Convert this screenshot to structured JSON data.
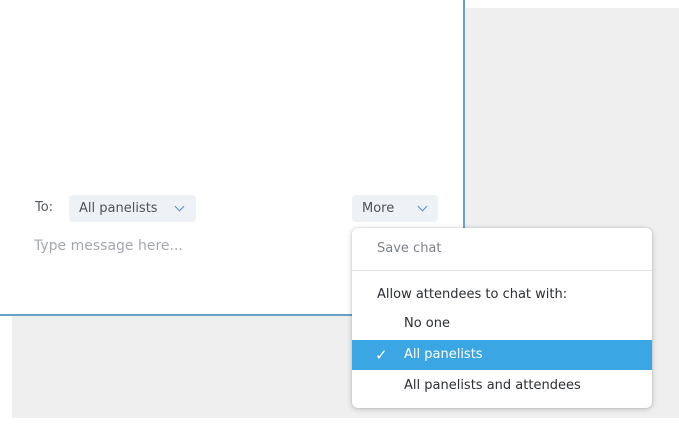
{
  "chat": {
    "to_label": "To:",
    "recipient": "All panelists",
    "more_label": "More",
    "message_placeholder": "Type message here..."
  },
  "menu": {
    "save_chat": "Save chat",
    "allow_label": "Allow attendees to chat with:",
    "selected_option": "All panelists",
    "options": [
      {
        "label": "No one"
      },
      {
        "label": "All panelists"
      },
      {
        "label": "All panelists and attendees"
      }
    ]
  },
  "colors": {
    "accent": "#3aa6e3",
    "panel_border": "#6aa0c6"
  }
}
